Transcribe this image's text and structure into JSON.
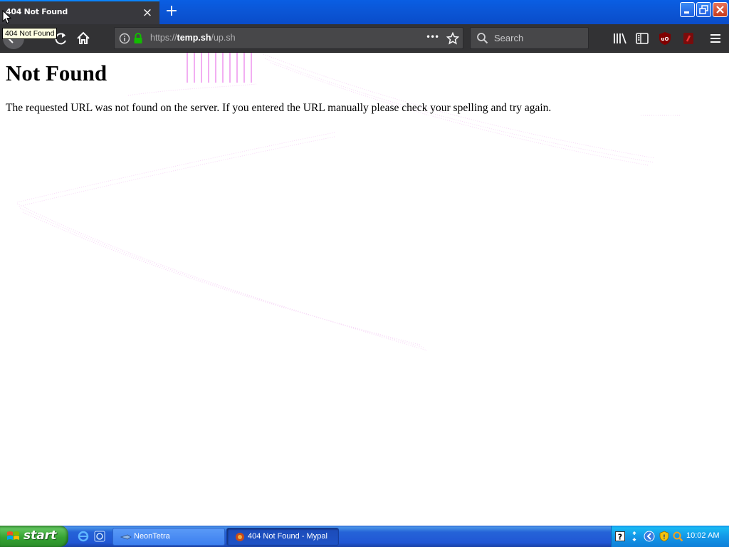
{
  "browser": {
    "tab": {
      "title": "404 Not Found",
      "close_glyph": "×"
    },
    "new_tab_glyph": "+",
    "tooltip": "404 Not Found",
    "url": {
      "scheme": "https://",
      "host": "temp.sh",
      "path": "/up.sh"
    },
    "page_actions_glyph": "•••",
    "search_placeholder": "Search",
    "icons": [
      "back-icon",
      "reload-icon",
      "home-icon",
      "info-icon",
      "lock-icon",
      "bookmark-star-icon",
      "search-icon",
      "library-icon",
      "sidebar-icon",
      "ublock-icon",
      "noscript-icon",
      "menu-icon"
    ],
    "window_controls": [
      "minimize-icon",
      "restore-icon",
      "close-icon"
    ]
  },
  "page": {
    "heading": "Not Found",
    "message": "The requested URL was not found on the server. If you entered the URL manually please check your spelling and try again."
  },
  "taskbar": {
    "start_label": "start",
    "quick_launch": [
      "internet-explorer-icon",
      "browser-icon"
    ],
    "tasks": [
      {
        "label": "NeonTetra",
        "active": false
      },
      {
        "label": "404 Not Found - Mypal",
        "active": true
      }
    ],
    "tray_icons": [
      "help-icon",
      "network-icon",
      "back-arrow-icon",
      "shield-icon",
      "search-tray-icon"
    ],
    "clock": "10:02 AM"
  },
  "colors": {
    "chrome_dark": "#323234",
    "tab_dark": "#38383d",
    "urlbar": "#474749",
    "xp_blue": "#2157d4",
    "xp_green": "#36a333",
    "artifact_magenta": "#e040e0"
  }
}
